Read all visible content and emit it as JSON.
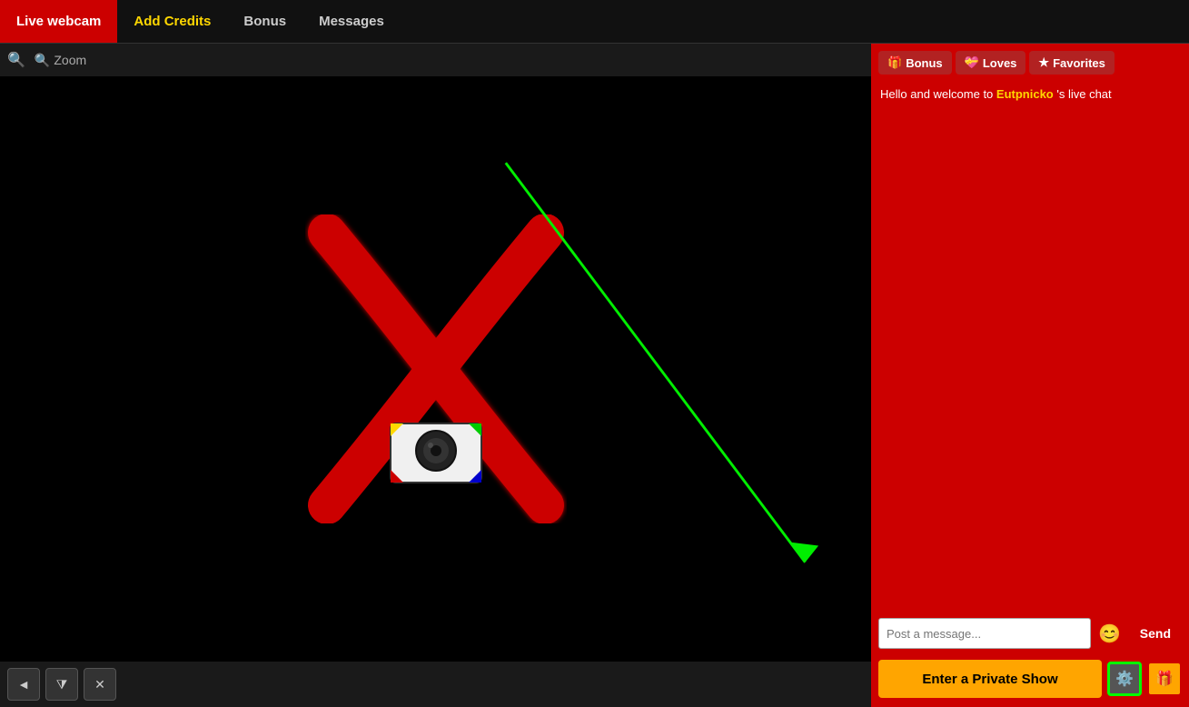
{
  "nav": {
    "items": [
      {
        "id": "live-webcam",
        "label": "Live webcam",
        "active": true
      },
      {
        "id": "add-credits",
        "label": "Add Credits",
        "highlight": true
      },
      {
        "id": "bonus",
        "label": "Bonus"
      },
      {
        "id": "messages",
        "label": "Messages"
      }
    ]
  },
  "video": {
    "zoom_label": "Zoom",
    "controls": [
      "◄",
      "⧩",
      "✕"
    ]
  },
  "chat": {
    "top_buttons": [
      {
        "id": "bonus",
        "label": "Bonus",
        "icon": "🎁"
      },
      {
        "id": "loves",
        "label": "Loves",
        "icon": "💝"
      },
      {
        "id": "favorites",
        "label": "Favorites",
        "icon": "★"
      }
    ],
    "welcome_text": "Hello and welcome to ",
    "username": "Eutpnicko",
    "welcome_suffix": " 's live chat",
    "input_placeholder": "Post a message...",
    "send_label": "Send",
    "private_show_label": "Enter a Private Show",
    "emoji_icon": "😊"
  }
}
